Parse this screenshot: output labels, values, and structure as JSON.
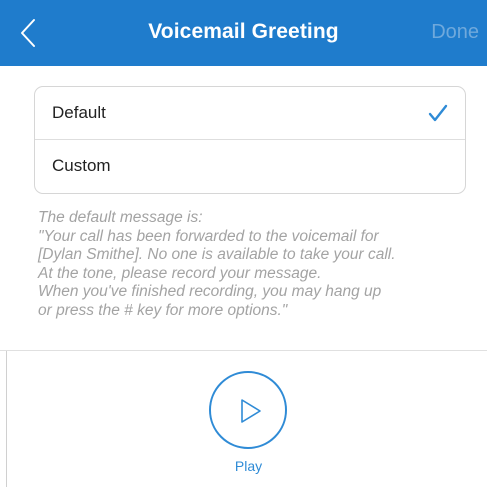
{
  "header": {
    "title": "Voicemail Greeting",
    "done_label": "Done",
    "back_icon": "chevron-left-icon",
    "background_color": "#1f7ccc"
  },
  "options": {
    "items": [
      {
        "label": "Default",
        "selected": true
      },
      {
        "label": "Custom",
        "selected": false
      }
    ],
    "check_icon": "checkmark-icon",
    "accent_color": "#2f8bd6"
  },
  "description": {
    "lines": [
      "The default message is:",
      "\"Your call has been forwarded to the voicemail for",
      "[Dylan Smithe]. No one is available to take your call.",
      "At the tone, please record your message.",
      "When you've finished recording, you may hang up",
      "or press the # key for more options.\""
    ]
  },
  "player": {
    "play_label": "Play",
    "play_icon": "play-icon"
  }
}
